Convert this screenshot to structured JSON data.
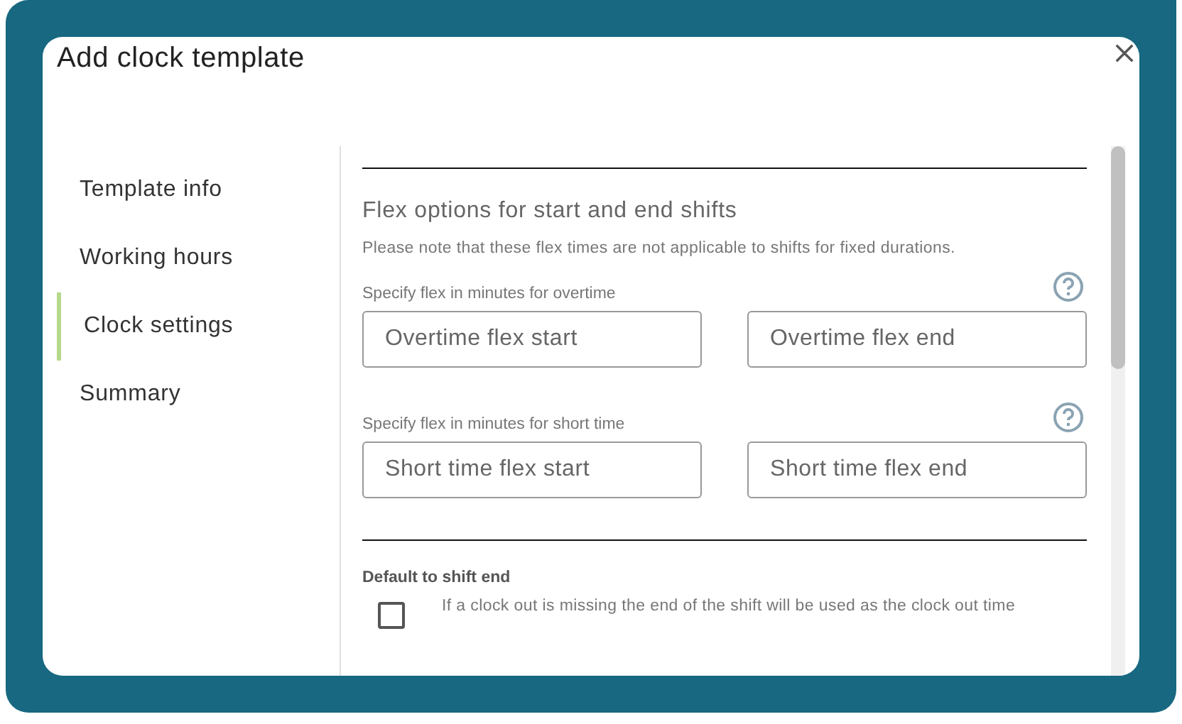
{
  "dialog": {
    "title": "Add clock template"
  },
  "sidebar": {
    "items": [
      {
        "label": "Template info",
        "selected": false
      },
      {
        "label": "Working hours",
        "selected": false
      },
      {
        "label": "Clock settings",
        "selected": true
      },
      {
        "label": "Summary",
        "selected": false
      }
    ]
  },
  "section": {
    "heading": "Flex options for start and end shifts",
    "note": "Please note that these flex times are not applicable to shifts for fixed durations.",
    "groups": [
      {
        "label": "Specify flex in minutes for overtime",
        "fields": [
          {
            "placeholder": "Overtime flex start"
          },
          {
            "placeholder": "Overtime flex end"
          }
        ]
      },
      {
        "label": "Specify flex in minutes for short time",
        "fields": [
          {
            "placeholder": "Short time flex start"
          },
          {
            "placeholder": "Short time flex end"
          }
        ]
      }
    ]
  },
  "option": {
    "label": "Default to shift end",
    "description": "If a clock out is missing the end of the shift will be used as the clock out time",
    "checked": false
  }
}
